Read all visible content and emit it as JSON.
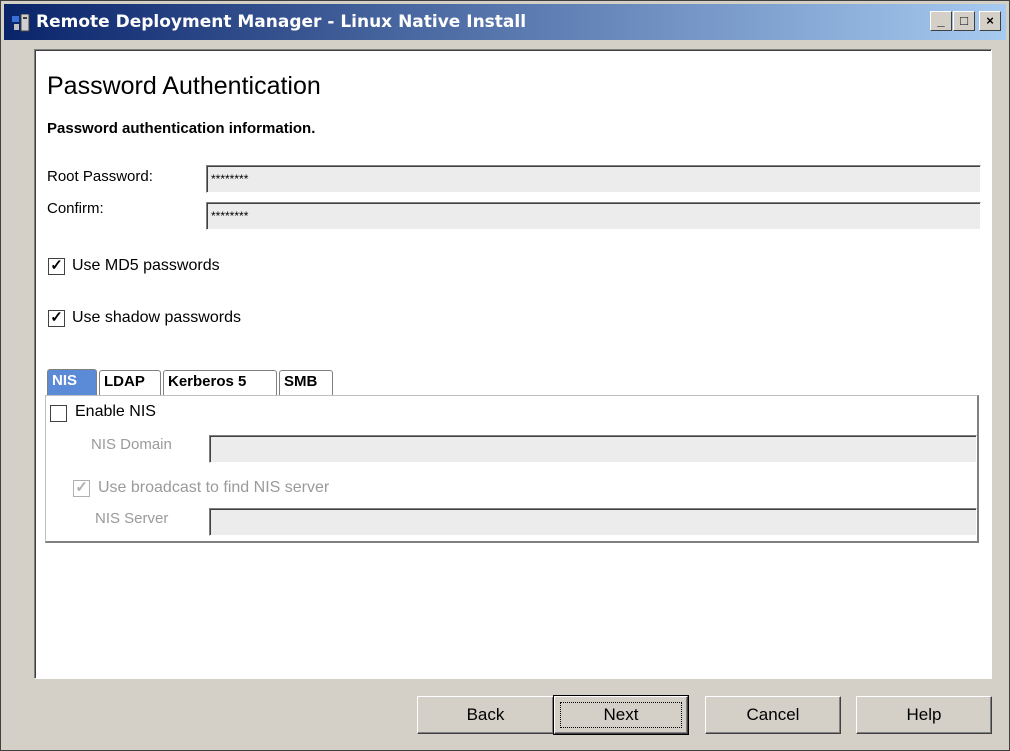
{
  "window": {
    "title": "Remote Deployment Manager - Linux Native Install",
    "minimize_label": "_",
    "maximize_label": "□",
    "close_label": "×"
  },
  "page": {
    "heading": "Password Authentication",
    "subheading": "Password authentication information."
  },
  "form": {
    "root_password_label": "Root Password:",
    "root_password_value": "********",
    "confirm_label": "Confirm:",
    "confirm_value": "********",
    "md5_label": "Use MD5 passwords",
    "md5_checked": true,
    "shadow_label": "Use shadow passwords",
    "shadow_checked": true
  },
  "tabs": [
    {
      "label": "NIS",
      "active": true
    },
    {
      "label": "LDAP",
      "active": false
    },
    {
      "label": "Kerberos 5",
      "active": false
    },
    {
      "label": "SMB",
      "active": false
    }
  ],
  "nis": {
    "enable_label": "Enable NIS",
    "enable_checked": false,
    "domain_label": "NIS Domain",
    "domain_value": "",
    "broadcast_label": "Use broadcast to find NIS server",
    "broadcast_checked": true,
    "server_label": "NIS Server",
    "server_value": ""
  },
  "buttons": {
    "back": "Back",
    "next": "Next",
    "cancel": "Cancel",
    "help": "Help"
  },
  "colors": {
    "titlebar_start": "#0a246a",
    "titlebar_end": "#a6caf0",
    "active_tab": "#5b8ad7"
  }
}
